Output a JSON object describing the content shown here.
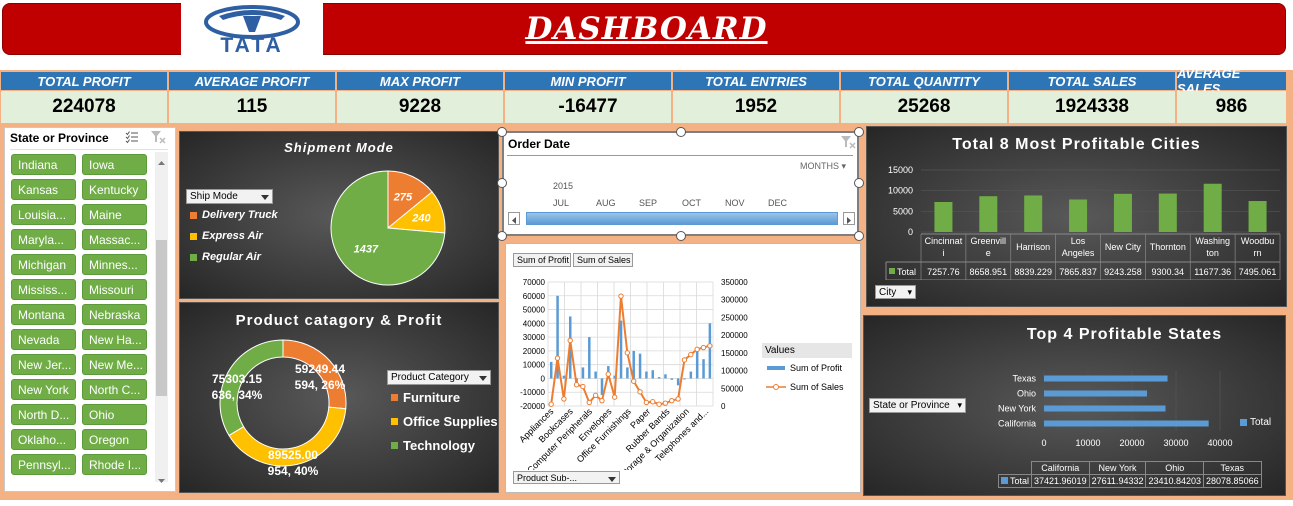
{
  "header": {
    "title": "DASHBOARD",
    "logo_text": "TATA"
  },
  "kpis": [
    {
      "label": "TOTAL PROFIT",
      "value": "224078"
    },
    {
      "label": "AVERAGE PROFIT",
      "value": "115"
    },
    {
      "label": "MAX PROFIT",
      "value": "9228"
    },
    {
      "label": "MIN PROFIT",
      "value": "-16477"
    },
    {
      "label": "TOTAL ENTRIES",
      "value": "1952"
    },
    {
      "label": "TOTAL QUANTITY",
      "value": "25268"
    },
    {
      "label": "TOTAL SALES",
      "value": "1924338"
    },
    {
      "label": "AVERAGE SALES",
      "value": "986"
    }
  ],
  "slicer": {
    "title": "State or Province",
    "items": [
      "Indiana",
      "Iowa",
      "Kansas",
      "Kentucky",
      "Louisia...",
      "Maine",
      "Maryla...",
      "Massac...",
      "Michigan",
      "Minnes...",
      "Mississ...",
      "Missouri",
      "Montana",
      "Nebraska",
      "Nevada",
      "New Ha...",
      "New Jer...",
      "New Me...",
      "New York",
      "North C...",
      "North D...",
      "Ohio",
      "Oklaho...",
      "Oregon",
      "Pennsyl...",
      "Rhode I..."
    ]
  },
  "shipment": {
    "title": "Shipment Mode",
    "filter_label": "Ship Mode",
    "legend": [
      "Delivery Truck",
      "Express Air",
      "Regular Air"
    ],
    "colors": [
      "#ed7d31",
      "#ffc000",
      "#70ad47"
    ]
  },
  "product": {
    "title": "Product catagory & Profit",
    "filter_label": "Product Category",
    "legend": [
      "Furniture",
      "Office Supplies",
      "Technology"
    ],
    "colors": [
      "#ed7d31",
      "#ffc000",
      "#70ad47"
    ],
    "labels": [
      {
        "line1": "59249.44",
        "line2": "594, 26%"
      },
      {
        "line1": "89525.00",
        "line2": "954, 40%"
      },
      {
        "line1": "75303.15",
        "line2": "636, 34%"
      }
    ]
  },
  "timeline": {
    "title": "Order Date",
    "mode": "MONTHS",
    "year": "2015",
    "months": [
      "JUL",
      "AUG",
      "SEP",
      "OCT",
      "NOV",
      "DEC"
    ]
  },
  "combo": {
    "profit_button": "Sum of Profit",
    "sales_button": "Sum of Sales",
    "legend_title": "Values",
    "legend": [
      "Sum of Profit",
      "Sum of Sales"
    ],
    "filter_label": "Product Sub-...",
    "colors": {
      "profit": "#5b9bd5",
      "sales": "#ed7d31"
    }
  },
  "cities": {
    "title": "Total 8 Most Profitable Cities",
    "filter_label": "City",
    "row_label": "Total",
    "names": [
      [
        "Cincinnat",
        "i"
      ],
      [
        "Greenvill",
        "e"
      ],
      [
        "Harrison"
      ],
      [
        "Los",
        "Angeles"
      ],
      [
        "New City"
      ],
      [
        "Thornton"
      ],
      [
        "Washing",
        "ton"
      ],
      [
        "Woodbu",
        "rn"
      ]
    ],
    "values_text": [
      "7257.76",
      "8658.951",
      "8839.229",
      "7865.837",
      "9243.258",
      "9300.34",
      "11677.36",
      "7495.061"
    ],
    "color": "#70ad47"
  },
  "states": {
    "title": "Top 4 Profitable States",
    "filter_label": "State or Province",
    "legend": "Total",
    "row_label": "Total",
    "names": [
      "California",
      "New York",
      "Ohio",
      "Texas"
    ],
    "values_text": [
      "37421.96019",
      "27611.94332",
      "23410.84203",
      "28078.85066"
    ],
    "color": "#5b9bd5"
  },
  "chart_data": [
    {
      "type": "pie",
      "title": "Shipment Mode",
      "categories": [
        "Delivery Truck",
        "Express Air",
        "Regular Air"
      ],
      "values": [
        275,
        240,
        1437
      ]
    },
    {
      "type": "pie",
      "title": "Product catagory & Profit",
      "categories": [
        "Furniture",
        "Office Supplies",
        "Technology"
      ],
      "values": [
        59249.44,
        89525.0,
        75303.15
      ],
      "counts": [
        594,
        954,
        636
      ]
    },
    {
      "type": "bar",
      "title": "Total 8 Most Profitable Cities",
      "categories": [
        "Cincinnati",
        "Greenville",
        "Harrison",
        "Los Angeles",
        "New City",
        "Thornton",
        "Washington",
        "Woodburn"
      ],
      "values": [
        7257.76,
        8658.951,
        8839.229,
        7865.837,
        9243.258,
        9300.34,
        11677.36,
        7495.061
      ],
      "ylim": [
        0,
        15000
      ],
      "yticks": [
        "0",
        "5000",
        "10000",
        "15000"
      ]
    },
    {
      "type": "bar",
      "title": "Top 4 Profitable States",
      "orientation": "horizontal",
      "categories": [
        "California",
        "New York",
        "Ohio",
        "Texas"
      ],
      "values": [
        37421.96019,
        27611.94332,
        23410.84203,
        28078.85066
      ],
      "xlim": [
        0,
        40000
      ],
      "xticks": [
        "0",
        "10000",
        "20000",
        "30000",
        "40000"
      ]
    },
    {
      "type": "line",
      "categories": [
        "Appliances",
        "Bookcases",
        "Computer Peripherals",
        "Envelopes",
        "Office Furnishings",
        "Paper",
        "Rubber Bands",
        "Storage & Organization",
        "Telephones and..."
      ],
      "series": [
        {
          "name": "Sum of Profit",
          "values": [
            12000,
            60000,
            2000,
            45000,
            -3000,
            8000,
            30000,
            5000,
            -12000,
            9000,
            2000,
            42000,
            8000,
            20000,
            18000,
            5000,
            6000,
            1000,
            3000,
            -1000,
            -5000,
            0,
            5000,
            22000,
            14000,
            40000
          ]
        },
        {
          "name": "Sum of Sales",
          "values": [
            5000,
            135000,
            20000,
            185000,
            60000,
            55000,
            10000,
            30000,
            15000,
            90000,
            25000,
            310000,
            150000,
            70000,
            40000,
            10000,
            12000,
            5000,
            8000,
            15000,
            20000,
            130000,
            145000,
            160000,
            165000,
            170000
          ]
        }
      ],
      "ylim_left": [
        -20000,
        70000
      ],
      "ylim_right": [
        0,
        350000
      ],
      "yticks_left": [
        "-20000",
        "-10000",
        "0",
        "10000",
        "20000",
        "30000",
        "40000",
        "50000",
        "60000",
        "70000"
      ],
      "yticks_right": [
        "0",
        "50000",
        "100000",
        "150000",
        "200000",
        "250000",
        "300000",
        "350000"
      ],
      "xticks": [
        "Appliances",
        "Bookcases",
        "Computer Peripherals",
        "Envelopes",
        "Office Furnishings",
        "Paper",
        "Rubber Bands",
        "Storage & Organization",
        "Telephones and..."
      ]
    }
  ]
}
